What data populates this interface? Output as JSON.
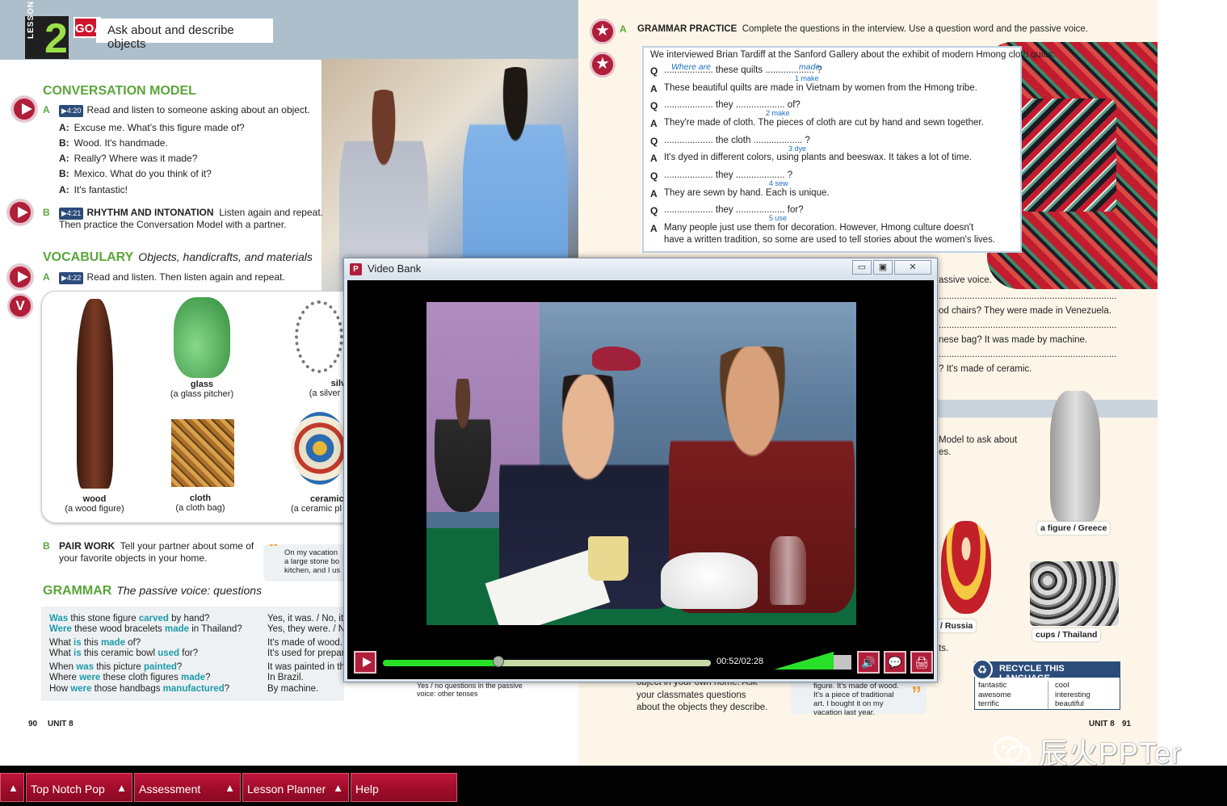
{
  "left_page": {
    "lesson_word": "LESSON",
    "lesson_number": "2",
    "goal_badge": "GOAL",
    "goal_text": "Ask about and describe objects",
    "conversation_heading": "CONVERSATION MODEL",
    "conv_a_label": "A",
    "conv_a_audio": "4:20",
    "conv_a_text": "Read and listen to someone asking about an object.",
    "dialog": [
      {
        "speaker": "A:",
        "text": "Excuse me. What's this figure made of?"
      },
      {
        "speaker": "B:",
        "text": "Wood. It's handmade."
      },
      {
        "speaker": "A:",
        "text": "Really? Where was it made?"
      },
      {
        "speaker": "B:",
        "text": "Mexico. What do you think of it?"
      },
      {
        "speaker": "A:",
        "text": "It's fantastic!"
      }
    ],
    "conv_b_label": "B",
    "conv_b_audio": "4:21",
    "conv_b_bold": "RHYTHM AND INTONATION",
    "conv_b_text": "Listen again and repeat.",
    "conv_b_text2": "Then practice the Conversation Model with a partner.",
    "vocab_heading": "VOCABULARY",
    "vocab_sub": "Objects, handicrafts, and materials",
    "vocab_a_label": "A",
    "vocab_a_audio": "4:22",
    "vocab_a_text": "Read and listen. Then listen again and repeat.",
    "v_button": "V",
    "objects": [
      {
        "material": "wood",
        "example": "(a wood figure)"
      },
      {
        "material": "glass",
        "example": "(a glass pitcher)"
      },
      {
        "material": "cloth",
        "example": "(a cloth bag)"
      },
      {
        "material": "silv",
        "example": "(a silver r"
      },
      {
        "material": "ceramic",
        "example": "(a ceramic pl"
      }
    ],
    "pair_label": "B",
    "pair_bold": "PAIR WORK",
    "pair_text": "Tell your partner about some of",
    "pair_text2": "your favorite objects in your home.",
    "quote_text": "On my vacation a large stone bo kitchen, and I us",
    "grammar_heading": "GRAMMAR",
    "grammar_sub": "The passive voice: questions",
    "grammar_q": [
      [
        {
          "t": "Was",
          "h": true
        },
        {
          "t": " this stone figure ",
          "h": false
        },
        {
          "t": "carved",
          "h": true
        },
        {
          "t": " by hand?",
          "h": false
        }
      ],
      [
        {
          "t": "Were",
          "h": true
        },
        {
          "t": " these wood bracelets ",
          "h": false
        },
        {
          "t": "made",
          "h": true
        },
        {
          "t": " in Thailand?",
          "h": false
        }
      ],
      [
        {
          "t": "What ",
          "h": false
        },
        {
          "t": "is",
          "h": true
        },
        {
          "t": " this ",
          "h": false
        },
        {
          "t": "made",
          "h": true
        },
        {
          "t": " of?",
          "h": false
        }
      ],
      [
        {
          "t": "What ",
          "h": false
        },
        {
          "t": "is",
          "h": true
        },
        {
          "t": " this ceramic bowl ",
          "h": false
        },
        {
          "t": "used",
          "h": true
        },
        {
          "t": " for?",
          "h": false
        }
      ],
      [
        {
          "t": "When ",
          "h": false
        },
        {
          "t": "was",
          "h": true
        },
        {
          "t": " this picture ",
          "h": false
        },
        {
          "t": "painted",
          "h": true
        },
        {
          "t": "?",
          "h": false
        }
      ],
      [
        {
          "t": "Where ",
          "h": false
        },
        {
          "t": "were",
          "h": true
        },
        {
          "t": " these cloth figures ",
          "h": false
        },
        {
          "t": "made",
          "h": true
        },
        {
          "t": "?",
          "h": false
        }
      ],
      [
        {
          "t": "How ",
          "h": false
        },
        {
          "t": "were",
          "h": true
        },
        {
          "t": " those handbags ",
          "h": false
        },
        {
          "t": "manufactured",
          "h": true
        },
        {
          "t": "?",
          "h": false
        }
      ]
    ],
    "grammar_a": [
      "Yes, it was. / No, it",
      "Yes, they were. / N",
      "It's made of wood.",
      "It's used for prepar",
      "It was painted in th",
      "In Brazil.",
      "By machine."
    ],
    "note_text": "Yes / no questions in the passive voice: other tenses",
    "page_num": "90",
    "unit": "UNIT 8"
  },
  "right_page": {
    "gp_label": "A",
    "gp_bold": "GRAMMAR PRACTICE",
    "gp_text": "Complete the questions in the interview. Use a question word and the passive voice.",
    "intro": "We interviewed Brian Tardiff at the Sanford Gallery about the exhibit of modern Hmong cloth quilts.",
    "q1_mid": "these quilts",
    "q1_ans1": "Where are",
    "q1_ans2": "made",
    "q1_end": "?",
    "hint1": "1 make",
    "a1": "These beautiful quilts are made in Vietnam by women from the Hmong tribe.",
    "q2_mid": "they",
    "q2_end": "of?",
    "hint2": "2 make",
    "a2": "They're made of cloth. The pieces of cloth are cut by hand and sewn together.",
    "q3_mid": "the cloth",
    "q3_end": "?",
    "hint3": "3 dye",
    "a3": "It's dyed in different colors, using plants and beeswax. It takes a lot of time.",
    "q4_mid": "they",
    "q4_end": "?",
    "hint4": "4 sew",
    "a4": "They are sewn by hand. Each is unique.",
    "q5_mid": "they",
    "q5_end": "for?",
    "hint5": "5 use",
    "a5": "Many people just use them for decoration. However, Hmong culture doesn't",
    "a5b": "have a written tradition, so some are used to tell stories about the women's lives.",
    "q_letter": "Q",
    "a_letter": "A",
    "dots": "...................",
    "frag1": "assive voice.",
    "frag2": "od chairs? They were made in Venezuela.",
    "frag3": "nese bag? It was made by machine.",
    "frag4": "? It's made of ceramic.",
    "frag_dots": ".....................................................................",
    "frag_q": "?",
    "frag5": "Model to ask about",
    "frag6": "es.",
    "frag7": "ts.",
    "frag8": "object in your own home. Ask",
    "frag9": "your classmates questions",
    "frag10": "about the objects they describe.",
    "cap_figure": "a figure / Greece",
    "cap_russia": "/ Russia",
    "cap_cups": "cups / Thailand",
    "recycle_title": "RECYCLE THIS LANGUAGE.",
    "recycle_col1": [
      "fantastic",
      "awesome",
      "terrific"
    ],
    "recycle_col2": [
      "cool",
      "interesting",
      "beautiful"
    ],
    "bottom_quote": "figure. It's made of wood. It's a piece of traditional art. I bought it on my vacation last year.",
    "page_num": "91",
    "unit": "UNIT 8",
    "watermark": "辰火PPTer"
  },
  "video": {
    "window_title": "Video Bank",
    "logo": "P",
    "min_glyph": "▭",
    "max_glyph": "▣",
    "close_glyph": "✕",
    "time": "00:52/02:28",
    "progress": 0.352
  },
  "taskbar": {
    "items": [
      {
        "label": "Top Notch Pop"
      },
      {
        "label": "Assessment"
      },
      {
        "label": "Lesson Planner"
      },
      {
        "label": "Help"
      }
    ],
    "arrow": "▲"
  },
  "colors": {
    "accent": "#b01e3a",
    "green": "#5aa63a",
    "teal": "#1d9aa8"
  }
}
